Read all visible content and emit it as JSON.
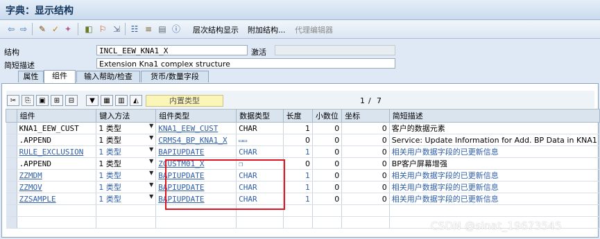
{
  "window": {
    "title": "字典：显示结构"
  },
  "toolbar": {
    "hierarchy_label": "层次结构显示",
    "append_label": "附加结构...",
    "proxy_editor_label": "代理编辑器"
  },
  "form": {
    "structure_label": "结构",
    "structure_value": "INCL_EEW_KNA1_X",
    "status_value": "激活",
    "desc_label": "简短描述",
    "desc_value": "Extension Kna1 complex structure"
  },
  "tabs": [
    "属性",
    "组件",
    "输入帮助/检查",
    "货币/数量字段"
  ],
  "grid_toolbar": {
    "builtin_type_label": "内置类型",
    "pager_current": "1",
    "pager_sep": "/",
    "pager_total": "7"
  },
  "columns": [
    "组件",
    "键入方法",
    "组件类型",
    "数据类型",
    "长度",
    "小数位",
    "坐标",
    "简短描述"
  ],
  "rows": [
    {
      "component": "KNA1_EEW_CUST",
      "method": "1 类型",
      "type": "KNA1_EEW_CUST",
      "datatype": "CHAR",
      "length": "1",
      "decimals": "0",
      "coord": "0",
      "desc": "客户的数据元素",
      "link": false
    },
    {
      "component": ".APPEND",
      "method": "1 类型",
      "type": "CRMS4_BP_KNA1_X",
      "datatype": "",
      "length": "0",
      "decimals": "0",
      "coord": "0",
      "desc": "Service: Update Information for Add. BP Data in KNA1",
      "link": false
    },
    {
      "component": "RULE_EXCLUSION",
      "method": "1 类型",
      "type": "BAPIUPDATE",
      "datatype": "CHAR",
      "length": "1",
      "decimals": "0",
      "coord": "0",
      "desc": "相关用户数据字段的已更新信息",
      "link": true
    },
    {
      "component": ".APPEND",
      "method": "1 类型",
      "type": "ZCUSTM01_X",
      "datatype": "",
      "length": "0",
      "decimals": "0",
      "coord": "0",
      "desc": "BP客户屏幕增强",
      "link": false
    },
    {
      "component": "ZZMDM",
      "method": "1 类型",
      "type": "BAPIUPDATE",
      "datatype": "CHAR",
      "length": "1",
      "decimals": "0",
      "coord": "0",
      "desc": "相关用户数据字段的已更新信息",
      "link": true
    },
    {
      "component": "ZZMOV",
      "method": "1 类型",
      "type": "BAPIUPDATE",
      "datatype": "CHAR",
      "length": "1",
      "decimals": "0",
      "coord": "0",
      "desc": "相关用户数据字段的已更新信息",
      "link": true
    },
    {
      "component": "ZZSAMPLE",
      "method": "1 类型",
      "type": "BAPIUPDATE",
      "datatype": "CHAR",
      "length": "1",
      "decimals": "0",
      "coord": "0",
      "desc": "相关用户数据字段的已更新信息",
      "link": true
    }
  ],
  "watermark": "CSDN @sinat_19673545",
  "colors": {
    "accent": "#2e5eaa",
    "highlight": "#e0141e",
    "title": "#14355c"
  }
}
